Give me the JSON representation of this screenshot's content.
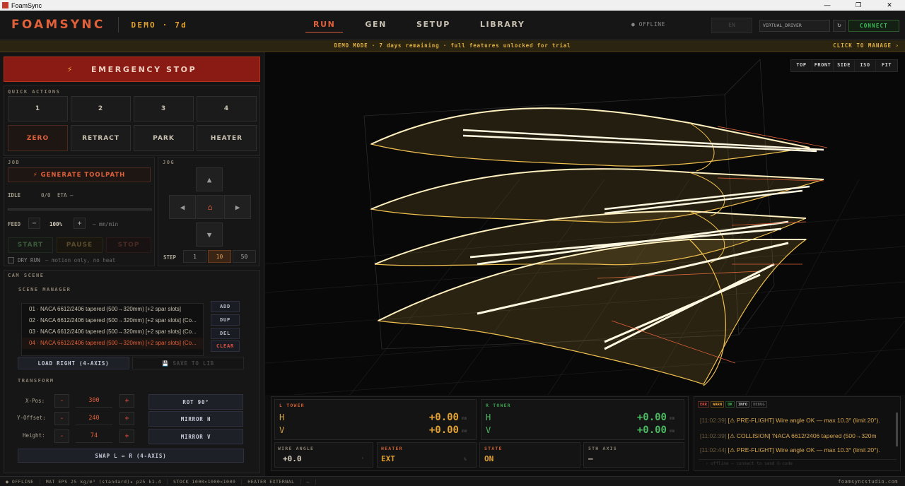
{
  "window": {
    "title": "FoamSync",
    "controls": [
      "—",
      "❐",
      "✕"
    ]
  },
  "header": {
    "logo": "FOAMSYNC",
    "demo": "DEMO · 7d",
    "tabs": [
      "RUN",
      "GEN",
      "SETUP",
      "LIBRARY"
    ],
    "active_tab": "RUN",
    "status": "● OFFLINE",
    "lang": "EN",
    "driver": "VIRTUAL_DRIVER",
    "refresh_icon": "↻",
    "connect": "CONNECT"
  },
  "banner": {
    "text": "DEMO MODE · 7 days remaining · full features unlocked for trial",
    "manage": "CLICK TO MANAGE ›"
  },
  "estop": {
    "label": "EMERGENCY STOP",
    "icon": "⚡"
  },
  "quick_actions": {
    "label": "QUICK ACTIONS",
    "row1": [
      "1",
      "2",
      "3",
      "4"
    ],
    "row2": [
      "ZERO",
      "RETRACT",
      "PARK",
      "HEATER"
    ]
  },
  "job": {
    "label": "JOB",
    "generate": "⚡  GENERATE TOOLPATH",
    "state": "IDLE",
    "progress_text": "0/0",
    "eta": "ETA —",
    "feed_label": "FEED",
    "feed_minus": "−",
    "feed_value": "100%",
    "feed_plus": "+",
    "feed_unit": "— mm/min",
    "start": "START",
    "pause": "PAUSE",
    "stop": "STOP",
    "dry_run": "DRY RUN",
    "dry_run_note": "— motion only, no heat"
  },
  "jog": {
    "label": "JOG",
    "up": "▲",
    "down": "▼",
    "left": "◀",
    "right": "▶",
    "home": "⌂",
    "step_label": "STEP",
    "steps": [
      "1",
      "10",
      "50"
    ],
    "active_step": "10"
  },
  "cam": {
    "label": "CAM SCENE",
    "scene_manager": "SCENE MANAGER",
    "scenes": [
      "01 · NACA 6612/2406 tapered (500→320mm)  [+2 spar slots]",
      "02 · NACA 6612/2406 tapered (500→320mm)  [+2 spar slots] (Co...",
      "03 · NACA 6612/2406 tapered (500→320mm)  [+2 spar slots] (Co...",
      "04 · NACA 6612/2406 tapered (500→320mm)  [+2 spar slots] (Co..."
    ],
    "selected_index": 3,
    "buttons": [
      "ADD",
      "DUP",
      "DEL",
      "CLEAR"
    ],
    "load_right": "LOAD RIGHT (4-AXIS)",
    "save_to_lib": "💾  SAVE TO LIB",
    "transform": "TRANSFORM",
    "xpos_label": "X-Pos:",
    "xpos": "300",
    "yoff_label": "Y-Offset:",
    "yoff": "240",
    "height_label": "Height:",
    "height": "74",
    "minus": "-",
    "plus": "+",
    "rot": "ROT 90°",
    "mirror_h": "MIRROR H",
    "mirror_v": "MIRROR V",
    "swap": "SWAP L ↔ R (4-AXIS)"
  },
  "viewport": {
    "views": [
      "TOP",
      "FRONT",
      "SIDE",
      "ISO",
      "FIT"
    ]
  },
  "dro": {
    "l_label": "L TOWER",
    "r_label": "R TOWER",
    "h": "H",
    "v": "V",
    "l_h": "+0.00",
    "l_v": "+0.00",
    "r_h": "+0.00",
    "r_v": "+0.00",
    "unit": "mm",
    "wire_angle_label": "WIRE ANGLE",
    "wire_angle": "+0.0",
    "wire_unit": "°",
    "heater_label": "HEATER",
    "heater": "EXT",
    "heater_unit": "%",
    "state_label": "STATE",
    "state": "ON",
    "fifth_label": "5TH AXIS",
    "fifth": "—"
  },
  "console": {
    "tags": [
      "ERR",
      "WARN",
      "OK",
      "INFO",
      "DEBUG"
    ],
    "lines": [
      {
        "ts": "[11:02:39]",
        "msg": " [⚠ PRE-FLIGHT] Wire angle OK — max 10.3° (limit 20°)."
      },
      {
        "ts": "[11:02:39]",
        "msg": " [⚠ COLLISION] 'NACA 6612/2406 tapered (500→320m"
      },
      {
        "ts": "[11:02:44]",
        "msg": " [⚠ PRE-FLIGHT] Wire angle OK — max 10.3° (limit 20°)."
      }
    ],
    "placeholder": "› offline — connect to send G-code"
  },
  "statusbar": {
    "offline": "● OFFLINE",
    "mat": "MAT  EPS 25 kg/m³ (standard)★  p25  k1.4",
    "stock": "STOCK  1000×1000×1000",
    "heater": "HEATER  EXTERNAL",
    "dash": "—",
    "site": "foamsyncstudio.com"
  },
  "colors": {
    "accent": "#e0603a",
    "warn": "#e0a030",
    "ok": "#3bbf5a",
    "estop": "#8a1a14"
  }
}
